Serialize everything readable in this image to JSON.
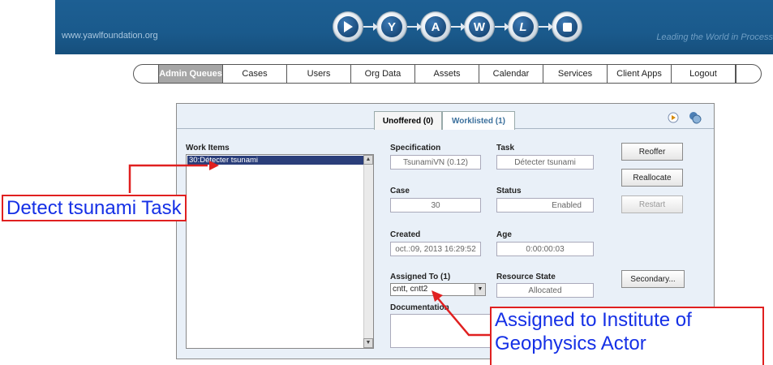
{
  "header": {
    "site_url": "www.yawlfoundation.org",
    "tagline": "Leading the World in Process",
    "logo_letters": [
      "Y",
      "A",
      "W",
      "L"
    ]
  },
  "nav": {
    "items": [
      "Admin Queues",
      "Cases",
      "Users",
      "Org Data",
      "Assets",
      "Calendar",
      "Services",
      "Client Apps",
      "Logout"
    ],
    "active": "Admin Queues"
  },
  "tabs": {
    "unoffered": "Unoffered (0)",
    "worklisted": "Worklisted (1)"
  },
  "work_items": {
    "label": "Work Items",
    "rows": [
      "30:Détecter tsunami"
    ]
  },
  "details": {
    "specification_label": "Specification",
    "specification_value": "TsunamiVN (0.12)",
    "task_label": "Task",
    "task_value": "Détecter tsunami",
    "case_label": "Case",
    "case_value": "30",
    "status_label": "Status",
    "status_value": "Enabled",
    "created_label": "Created",
    "created_value": "oct.:09, 2013 16:29:52",
    "age_label": "Age",
    "age_value": "0:00:00:03",
    "assigned_label": "Assigned To (1)",
    "assigned_value": "cntt, cntt2",
    "resource_state_label": "Resource State",
    "resource_state_value": "Allocated",
    "documentation_label": "Documentation"
  },
  "buttons": {
    "reoffer": "Reoffer",
    "reallocate": "Reallocate",
    "restart": "Restart",
    "secondary": "Secondary..."
  },
  "annotations": {
    "detect_task": "Detect tsunami Task",
    "assigned_line1": "Assigned to Institute of",
    "assigned_line2": "Geophysics Actor",
    "color": "#e02020",
    "text_color": "#1530e6"
  }
}
